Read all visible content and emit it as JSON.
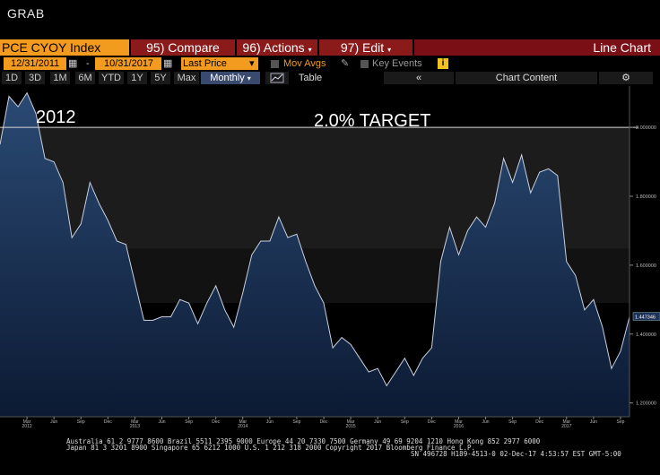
{
  "app": {
    "title": "GRAB"
  },
  "toolbar": {
    "ticker": "PCE CYOY Index",
    "compare_label": "95) Compare",
    "actions_label": "96) Actions",
    "edit_label": "97) Edit",
    "chart_type": "Line Chart",
    "start_date": "12/31/2011",
    "end_date": "10/31/2017",
    "field": "Last Price",
    "mov_avgs": "Mov Avgs",
    "key_events": "Key Events",
    "table_label": "Table",
    "collapse_label": "«",
    "chart_content_label": "Chart Content",
    "timeframes": [
      "1D",
      "3D",
      "1M",
      "6M",
      "YTD",
      "1Y",
      "5Y",
      "Max"
    ],
    "period": "Monthly"
  },
  "colors": {
    "orange": "#f29b1f",
    "red": "#8b1a1a",
    "fill_top": "#2a4a74",
    "fill_bottom": "#0c1a33",
    "line": "#c8d0e0"
  },
  "chart_data": {
    "type": "area",
    "annotations": {
      "year_label": "2012",
      "target_label": "2.0% TARGET"
    },
    "target_line": 2.0,
    "last_value_label": "1.447346",
    "ylim": [
      1.16,
      2.12
    ],
    "yticks": [
      "2.000000",
      "1.800000",
      "1.600000",
      "1.400000",
      "1.200000"
    ],
    "ytick_values": [
      2.0,
      1.8,
      1.6,
      1.4,
      1.2
    ],
    "xtick_labels": [
      "Mar",
      "Jun",
      "Sep",
      "Dec",
      "Mar",
      "Jun",
      "Sep",
      "Dec",
      "Mar",
      "Jun",
      "Sep",
      "Dec",
      "Mar",
      "Jun",
      "Sep",
      "Dec",
      "Mar",
      "Jun",
      "Sep",
      "Dec",
      "Mar",
      "Jun",
      "Sep"
    ],
    "year_labels": [
      "2012",
      "2013",
      "2014",
      "2015",
      "2016",
      "2017"
    ],
    "x": [
      "2011-12",
      "2012-01",
      "2012-02",
      "2012-03",
      "2012-04",
      "2012-05",
      "2012-06",
      "2012-07",
      "2012-08",
      "2012-09",
      "2012-10",
      "2012-11",
      "2012-12",
      "2013-01",
      "2013-02",
      "2013-03",
      "2013-04",
      "2013-05",
      "2013-06",
      "2013-07",
      "2013-08",
      "2013-09",
      "2013-10",
      "2013-11",
      "2013-12",
      "2014-01",
      "2014-02",
      "2014-03",
      "2014-04",
      "2014-05",
      "2014-06",
      "2014-07",
      "2014-08",
      "2014-09",
      "2014-10",
      "2014-11",
      "2014-12",
      "2015-01",
      "2015-02",
      "2015-03",
      "2015-04",
      "2015-05",
      "2015-06",
      "2015-07",
      "2015-08",
      "2015-09",
      "2015-10",
      "2015-11",
      "2015-12",
      "2016-01",
      "2016-02",
      "2016-03",
      "2016-04",
      "2016-05",
      "2016-06",
      "2016-07",
      "2016-08",
      "2016-09",
      "2016-10",
      "2016-11",
      "2016-12",
      "2017-01",
      "2017-02",
      "2017-03",
      "2017-04",
      "2017-05",
      "2017-06",
      "2017-07",
      "2017-08",
      "2017-09",
      "2017-10"
    ],
    "values": [
      1.95,
      2.09,
      2.06,
      2.1,
      2.04,
      1.91,
      1.9,
      1.84,
      1.68,
      1.72,
      1.84,
      1.78,
      1.73,
      1.67,
      1.66,
      1.55,
      1.44,
      1.44,
      1.45,
      1.45,
      1.5,
      1.49,
      1.43,
      1.49,
      1.54,
      1.47,
      1.42,
      1.52,
      1.63,
      1.67,
      1.67,
      1.74,
      1.68,
      1.69,
      1.61,
      1.54,
      1.49,
      1.36,
      1.39,
      1.37,
      1.33,
      1.29,
      1.3,
      1.25,
      1.29,
      1.33,
      1.28,
      1.33,
      1.36,
      1.61,
      1.71,
      1.63,
      1.7,
      1.74,
      1.71,
      1.78,
      1.91,
      1.84,
      1.92,
      1.81,
      1.87,
      1.88,
      1.86,
      1.61,
      1.57,
      1.47,
      1.5,
      1.42,
      1.3,
      1.35,
      1.45
    ]
  },
  "footer": {
    "line1": "Australia 61 2 9777 8600 Brazil 5511 2395 9000 Europe 44 20 7330 7500 Germany 49 69 9204 1210 Hong Kong 852 2977 6000",
    "line2": "Japan 81 3 3201 8900       Singapore 65 6212 1000       U.S. 1 212 318 2000            Copyright 2017 Bloomberg Finance L.P.",
    "line3": "SN 496728 H189-4513-0 02-Dec-17  4:53:57 EST  GMT-5:00"
  }
}
